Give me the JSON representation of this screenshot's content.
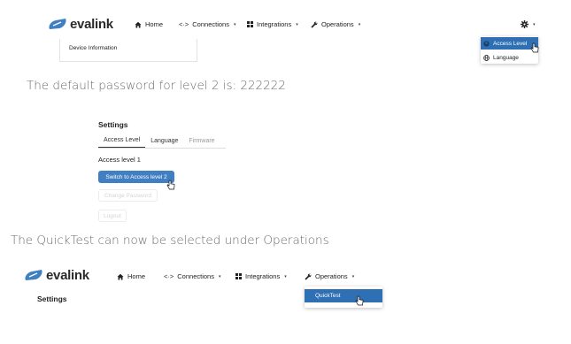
{
  "brand": {
    "name": "evalink",
    "logo_color": "#3f7fc2"
  },
  "nav_top": {
    "home": "Home",
    "connections": "Connections",
    "integrations": "Integrations",
    "operations": "Operations",
    "settings_icon": "gear-icon"
  },
  "top_dropdown": {
    "items": [
      {
        "label": "Access Level",
        "icon": "user-circle-icon",
        "active": true
      },
      {
        "label": "Language",
        "icon": "globe-icon",
        "active": false
      }
    ]
  },
  "device_card": {
    "title": "Device Information"
  },
  "caption_1": "The default password for level 2 is: 222222",
  "settings_panel": {
    "title": "Settings",
    "tabs": [
      {
        "label": "Access Level",
        "state": "active"
      },
      {
        "label": "Language",
        "state": "normal"
      },
      {
        "label": "Firmware",
        "state": "disabled"
      }
    ],
    "access_level_text": "Access level 1",
    "switch_button": "Switch to Access level 2",
    "change_password_button": "Change Password",
    "logout_button": "Logout"
  },
  "caption_2": "The QuickTest can now be selected under Operations",
  "nav_bottom": {
    "home": "Home",
    "connections": "Connections",
    "integrations": "Integrations",
    "operations": "Operations",
    "settings_title": "Settings",
    "operations_menu": {
      "items": [
        {
          "label": "QuickTest",
          "active": true
        }
      ]
    }
  },
  "colors": {
    "accent": "#2f6fb3",
    "button": "#3f7fc2",
    "caption": "#6b6b6b"
  }
}
